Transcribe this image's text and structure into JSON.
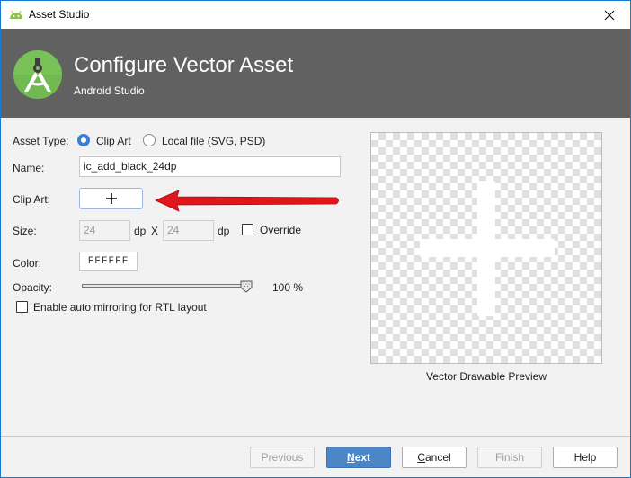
{
  "window": {
    "title": "Asset Studio",
    "close_icon": "close-icon",
    "app_icon": "android-icon"
  },
  "banner": {
    "heading": "Configure Vector Asset",
    "subheading": "Android Studio",
    "logo_icon": "android-studio-logo-icon"
  },
  "form": {
    "asset_type_label": "Asset Type:",
    "asset_type_options": [
      {
        "label": "Clip Art",
        "selected": true
      },
      {
        "label": "Local file (SVG, PSD)",
        "selected": false
      }
    ],
    "name_label": "Name:",
    "name_value": "ic_add_black_24dp",
    "clip_art_label": "Clip Art:",
    "clip_art_icon": "plus-icon",
    "size_label": "Size:",
    "size_width": "24",
    "size_height": "24",
    "size_unit": "dp",
    "size_separator": "X",
    "override_label": "Override",
    "override_checked": false,
    "color_label": "Color:",
    "color_value": "FFFFFF",
    "opacity_label": "Opacity:",
    "opacity_value": "100 %",
    "opacity_percent": 100,
    "rtl_label": "Enable auto mirroring for RTL layout",
    "rtl_checked": false
  },
  "annotation": {
    "arrow_color": "#e0161b"
  },
  "preview": {
    "caption": "Vector Drawable Preview",
    "icon": "plus-icon"
  },
  "buttons": {
    "previous": "Previous",
    "next_mnemonic": "N",
    "next_rest": "ext",
    "cancel_mnemonic": "C",
    "cancel_rest": "ancel",
    "finish": "Finish",
    "help": "Help"
  },
  "colors": {
    "accent": "#4a86c8",
    "banner_bg": "#616161",
    "android_green": "#78c257"
  }
}
